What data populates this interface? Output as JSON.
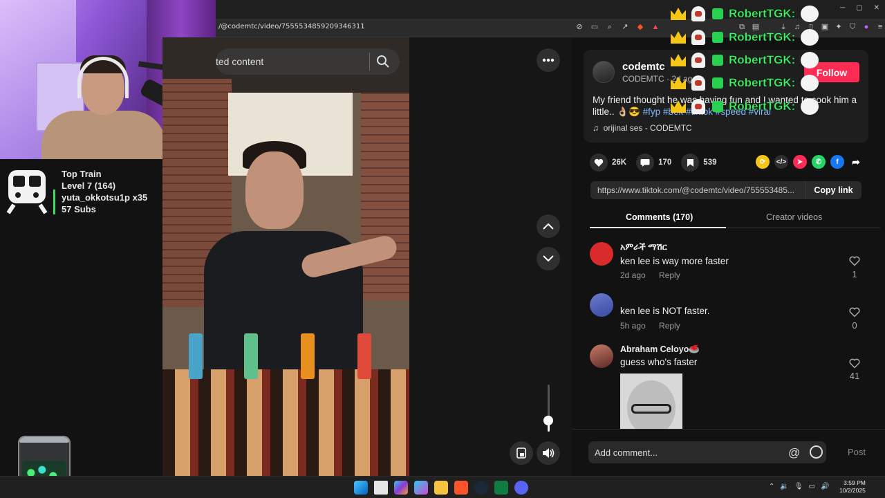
{
  "browser": {
    "url": "/@codemtc/video/7555534859209346311"
  },
  "search": {
    "placeholder": "ted content"
  },
  "overlay": {
    "train_title": "Top Train",
    "train_level": "Level 7  (164)",
    "train_user": "yuta_okkotsu1p x35",
    "train_subs": "57 Subs"
  },
  "post": {
    "author": "codemtc",
    "author_sub": "CODEMTC · 2d ago",
    "follow_label": "Follow",
    "caption": "My friend thought he was having fun and I wanted to cook him a little.. 👌🏼😎",
    "hashtags": "#fyp #bek #tiktok #speed #viral",
    "music": "orijinal ses - CODEMTC",
    "likes": "26K",
    "comments": "170",
    "saves": "539",
    "link": "https://www.tiktok.com/@codemtc/video/755553485...",
    "copy_label": "Copy link"
  },
  "tabs": {
    "comments": "Comments (170)",
    "creator": "Creator videos"
  },
  "comments": [
    {
      "name": "አምራች ማሽር",
      "text": "ken lee is way more faster",
      "time": "2d ago",
      "reply": "Reply",
      "likes": "1"
    },
    {
      "name": "",
      "text": "ken lee is NOT faster.",
      "time": "5h ago",
      "reply": "Reply",
      "likes": "0"
    },
    {
      "name": "Abraham Celoyo🥌",
      "text": "guess who's faster",
      "likes": "41"
    }
  ],
  "comment_box": {
    "placeholder": "Add comment...",
    "post_label": "Post"
  },
  "chat": {
    "name": "RobertTGK:"
  },
  "taskbar": {
    "time": "3:59 PM",
    "date": "10/2/2025"
  },
  "colors": {
    "accent": "#fe2c55",
    "link": "#7db7ff",
    "chat_name": "#44ee66"
  }
}
